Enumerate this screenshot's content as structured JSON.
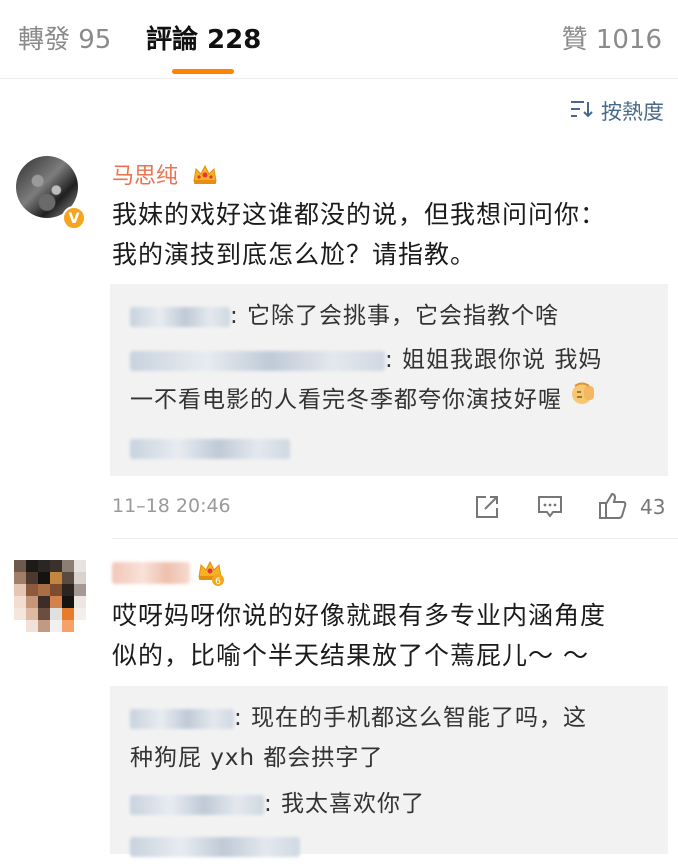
{
  "tabs": [
    {
      "label": "轉發 95"
    },
    {
      "label": "評論 228"
    },
    {
      "label": "贊 1016"
    }
  ],
  "sort": {
    "label": "按熱度",
    "icon": "sort-icon"
  },
  "comments": [
    {
      "username": "马思纯",
      "badge": "V",
      "text_lines": [
        "我妹的戏好这谁都没的说，但我想问问你：",
        "我的演技到底怎么尬？请指教。"
      ],
      "replies": [
        {
          "text": ": 它除了会挑事，它会指教个啥"
        },
        {
          "text": ": 姐姐我跟你说 我妈",
          "text2": "一不看电影的人看完冬季都夸你演技好喔"
        }
      ],
      "timestamp": "11–18 20:46",
      "likes": "43"
    },
    {
      "crown_level": "6",
      "text_lines": [
        "哎呀妈呀你说的好像就跟有多专业内涵角度",
        "似的，比喻个半天结果放了个蔫屁儿～ ～"
      ],
      "replies": [
        {
          "text": ": 现在的手机都这么智能了吗，这",
          "text2": "种狗屁 yxh 都会拱字了"
        },
        {
          "text": ": 我太喜欢你了"
        }
      ]
    }
  ],
  "colors": {
    "accent": "#ff8200",
    "username": "#eb7350",
    "link": "#49698c"
  }
}
